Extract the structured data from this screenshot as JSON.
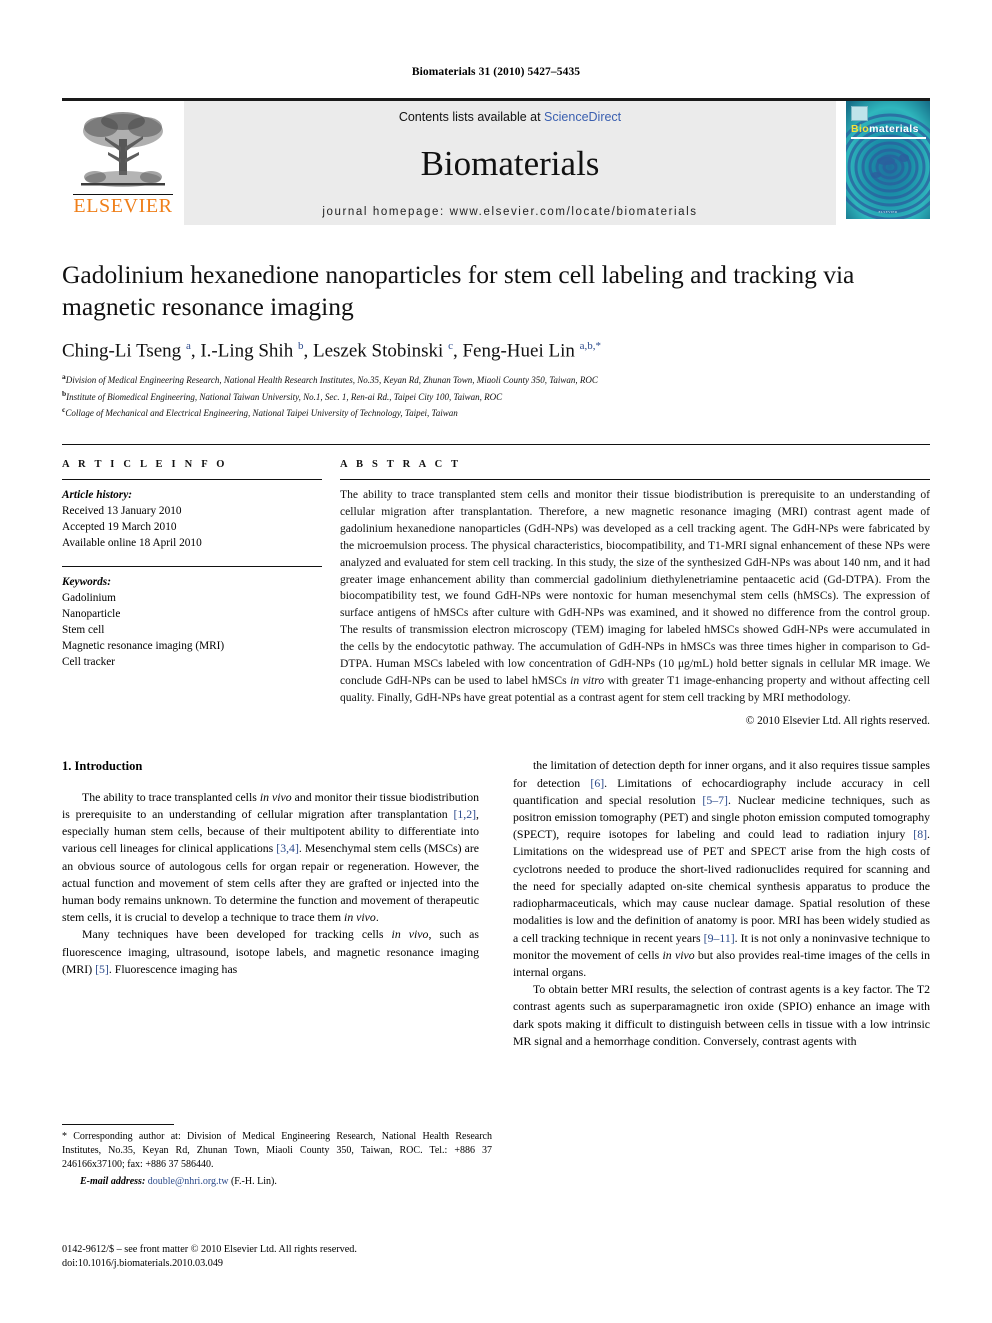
{
  "running_head": "Biomaterials 31 (2010) 5427–5435",
  "masthead": {
    "publisher": "ELSEVIER",
    "contents_prefix": "Contents lists available at ",
    "contents_link": "ScienceDirect",
    "journal_name": "Biomaterials",
    "homepage": "journal homepage: www.elsevier.com/locate/biomaterials",
    "cover": {
      "title_bio": "Bio",
      "title_rest": "materials",
      "footer": "ELSEVIER"
    },
    "accent_orange": "#ef7f1a",
    "link_blue": "#3a5fb0",
    "band_gray": "#ebebeb"
  },
  "article": {
    "title": "Gadolinium hexanedione nanoparticles for stem cell labeling and tracking via magnetic resonance imaging",
    "authors": [
      {
        "name": "Ching-Li Tseng",
        "marks": "a"
      },
      {
        "name": "I.-Ling Shih",
        "marks": "b"
      },
      {
        "name": "Leszek Stobinski",
        "marks": "c"
      },
      {
        "name": "Feng-Huei Lin",
        "marks": "a,b,*"
      }
    ],
    "affiliations": [
      {
        "mark": "a",
        "text": "Division of Medical Engineering Research, National Health Research Institutes, No.35, Keyan Rd, Zhunan Town, Miaoli County 350, Taiwan, ROC"
      },
      {
        "mark": "b",
        "text": "Institute of Biomedical Engineering, National Taiwan University, No.1, Sec. 1, Ren-ai Rd., Taipei City 100, Taiwan, ROC"
      },
      {
        "mark": "c",
        "text": "Collage of Mechanical and Electrical Engineering, National Taipei University of Technology, Taipei, Taiwan"
      }
    ]
  },
  "article_info": {
    "heading": "A R T I C L E   I N F O",
    "history_label": "Article history:",
    "history": [
      "Received 13 January 2010",
      "Accepted 19 March 2010",
      "Available online 18 April 2010"
    ],
    "keywords_label": "Keywords:",
    "keywords": [
      "Gadolinium",
      "Nanoparticle",
      "Stem cell",
      "Magnetic resonance imaging (MRI)",
      "Cell tracker"
    ]
  },
  "abstract": {
    "heading": "A B S T R A C T",
    "text": "The ability to trace transplanted stem cells and monitor their tissue biodistribution is prerequisite to an understanding of cellular migration after transplantation. Therefore, a new magnetic resonance imaging (MRI) contrast agent made of gadolinium hexanedione nanoparticles (GdH-NPs) was developed as a cell tracking agent. The GdH-NPs were fabricated by the microemulsion process. The physical characteristics, biocompatibility, and T1-MRI signal enhancement of these NPs were analyzed and evaluated for stem cell tracking. In this study, the size of the synthesized GdH-NPs was about 140 nm, and it had greater image enhancement ability than commercial gadolinium diethylenetriamine pentaacetic acid (Gd-DTPA). From the biocompatibility test, we found GdH-NPs were nontoxic for human mesenchymal stem cells (hMSCs). The expression of surface antigens of hMSCs after culture with GdH-NPs was examined, and it showed no difference from the control group. The results of transmission electron microscopy (TEM) imaging for labeled hMSCs showed GdH-NPs were accumulated in the cells by the endocytotic pathway. The accumulation of GdH-NPs in hMSCs was three times higher in comparison to Gd-DTPA. Human MSCs labeled with low concentration of GdH-NPs (10 μg/mL) hold better signals in cellular MR image. We conclude GdH-NPs can be used to label hMSCs in vitro with greater T1 image-enhancing property and without affecting cell quality. Finally, GdH-NPs have great potential as a contrast agent for stem cell tracking by MRI methodology.",
    "copyright": "© 2010 Elsevier Ltd. All rights reserved."
  },
  "body": {
    "section_number_title": "1.  Introduction",
    "left_paragraphs": [
      "The ability to trace transplanted cells in vivo and monitor their tissue biodistribution is prerequisite to an understanding of cellular migration after transplantation [1,2], especially human stem cells, because of their multipotent ability to differentiate into various cell lineages for clinical applications [3,4]. Mesenchymal stem cells (MSCs) are an obvious source of autologous cells for organ repair or regeneration. However, the actual function and movement of stem cells after they are grafted or injected into the human body remains unknown. To determine the function and movement of therapeutic stem cells, it is crucial to develop a technique to trace them in vivo.",
      "Many techniques have been developed for tracking cells in vivo, such as fluorescence imaging, ultrasound, isotope labels, and magnetic resonance imaging (MRI) [5]. Fluorescence imaging has"
    ],
    "right_paragraphs": [
      "the limitation of detection depth for inner organs, and it also requires tissue samples for detection [6]. Limitations of echocardiography include accuracy in cell quantification and special resolution [5–7]. Nuclear medicine techniques, such as positron emission tomography (PET) and single photon emission computed tomography (SPECT), require isotopes for labeling and could lead to radiation injury [8]. Limitations on the widespread use of PET and SPECT arise from the high costs of cyclotrons needed to produce the short-lived radionuclides required for scanning and the need for specially adapted on-site chemical synthesis apparatus to produce the radiopharmaceuticals, which may cause nuclear damage. Spatial resolution of these modalities is low and the definition of anatomy is poor. MRI has been widely studied as a cell tracking technique in recent years [9–11]. It is not only a noninvasive technique to monitor the movement of cells in vivo but also provides real-time images of the cells in internal organs.",
      "To obtain better MRI results, the selection of contrast agents is a key factor. The T2 contrast agents such as superparamagnetic iron oxide (SPIO) enhance an image with dark spots making it difficult to distinguish between cells in tissue with a low intrinsic MR signal and a hemorrhage condition. Conversely, contrast agents with"
    ]
  },
  "footnotes": {
    "corresponding": "* Corresponding author at: Division of Medical Engineering Research, National Health Research Institutes, No.35, Keyan Rd, Zhunan Town, Miaoli County 350, Taiwan, ROC. Tel.: +886 37 246166x37100; fax: +886 37 586440.",
    "email_label": "E-mail address:",
    "email": "double@nhri.org.tw",
    "email_suffix": "(F.-H. Lin).",
    "imprint_line1": "0142-9612/$ – see front matter © 2010 Elsevier Ltd. All rights reserved.",
    "imprint_line2": "doi:10.1016/j.biomaterials.2010.03.049"
  }
}
